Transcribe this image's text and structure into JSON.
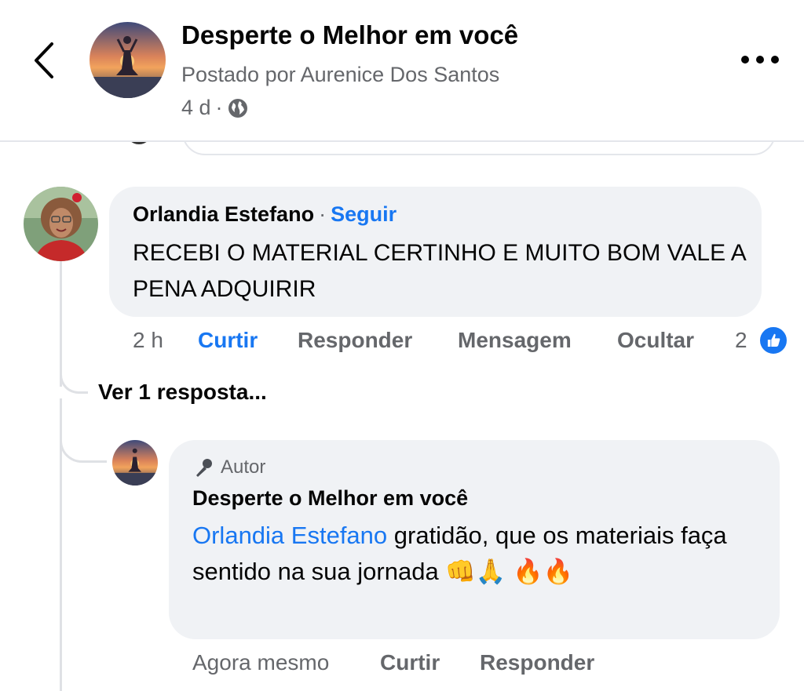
{
  "header": {
    "title": "Desperte o Melhor em você",
    "posted_by": "Postado por Aurenice Dos Santos",
    "age": "4 d",
    "separator": "·"
  },
  "comments": [
    {
      "author": "Orlandia Estefano",
      "separator": "·",
      "follow_label": "Seguir",
      "text": "RECEBI O MATERIAL CERTINHO E MUITO BOM VALE A PENA ADQUIRIR",
      "time": "2 h",
      "like_label": "Curtir",
      "reply_label": "Responder",
      "message_label": "Mensagem",
      "hide_label": "Ocultar",
      "reaction_count": "2"
    }
  ],
  "view_replies_label": "Ver 1 resposta...",
  "reply": {
    "badge": "Autor",
    "author": "Desperte o Melhor em você",
    "mention": "Orlandia Estefano",
    "text": " gratidão, que os materiais faça sentido na sua jornada 👊🙏 🔥🔥",
    "time": "Agora mesmo",
    "like_label": "Curtir",
    "reply_label": "Responder"
  },
  "colors": {
    "link_blue": "#1877f2",
    "bubble_gray": "#f0f2f5",
    "secondary_text": "#65676b"
  }
}
